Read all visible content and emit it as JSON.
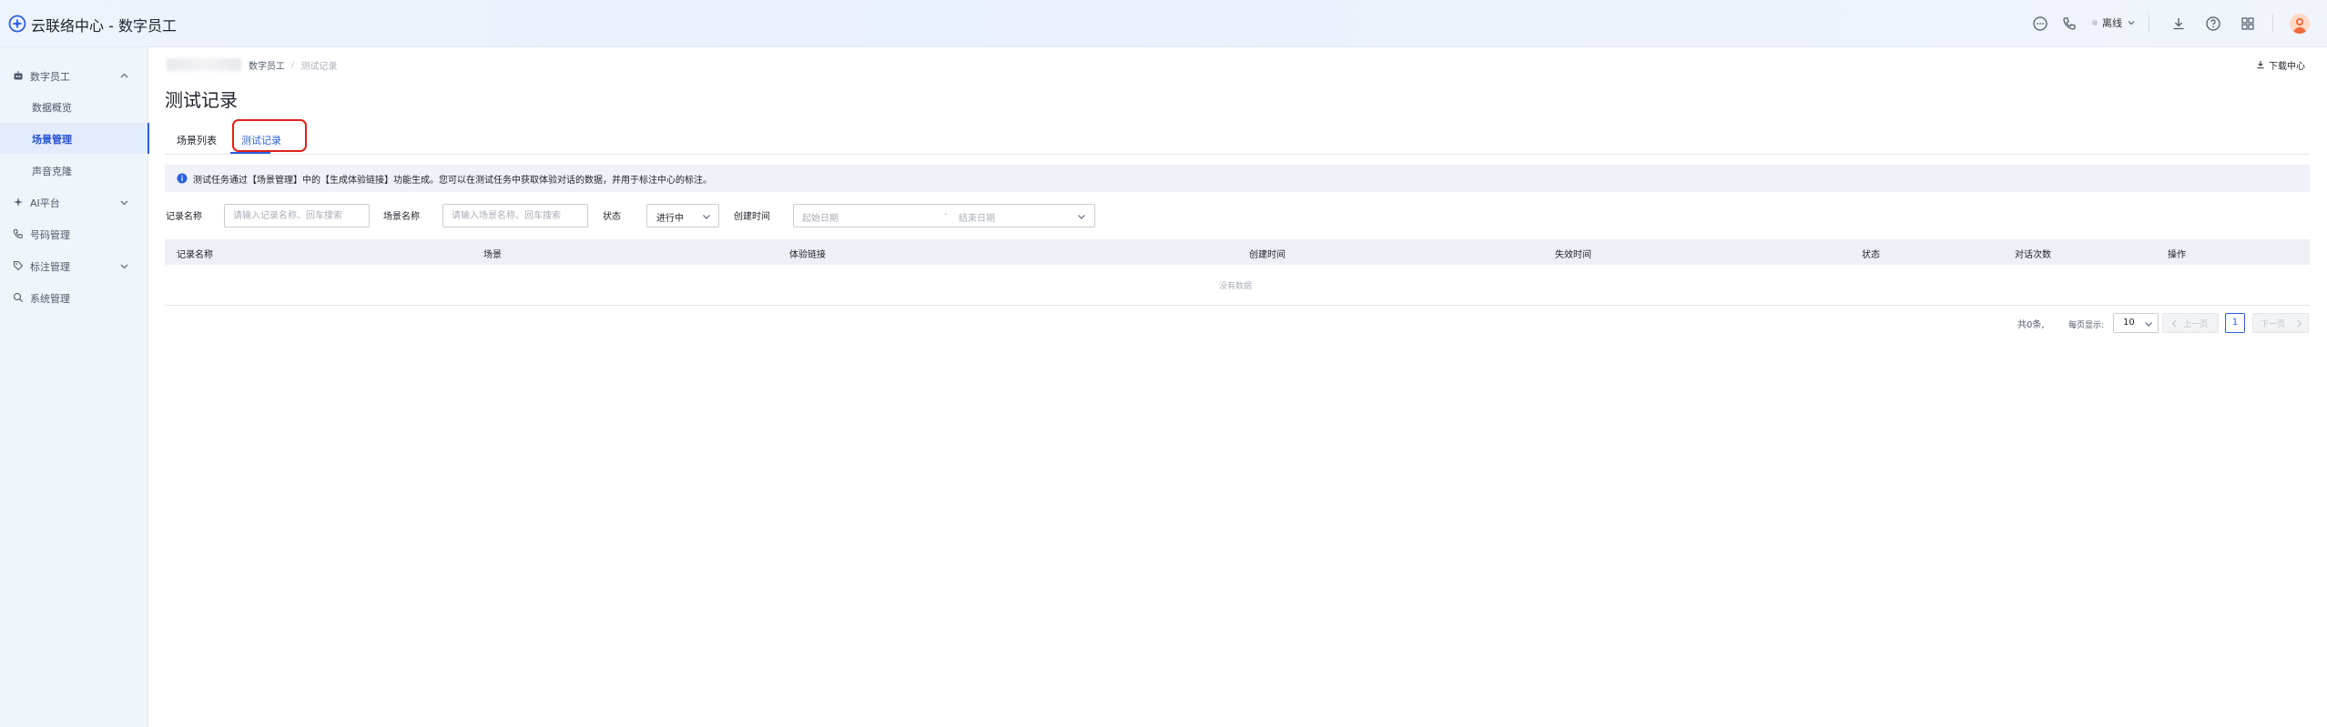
{
  "header": {
    "app_title": "云联络中心 - 数字员工",
    "status_label": "离线"
  },
  "sidebar": {
    "items": [
      {
        "label": "数字员工",
        "icon": "robot-icon",
        "expanded": true
      },
      {
        "label": "数据概览"
      },
      {
        "label": "场景管理",
        "active": true
      },
      {
        "label": "声音克隆"
      },
      {
        "label": "AI平台",
        "icon": "ai-icon",
        "expanded": false
      },
      {
        "label": "号码管理",
        "icon": "phone-icon"
      },
      {
        "label": "标注管理",
        "icon": "tag-icon",
        "expanded": false
      },
      {
        "label": "系统管理",
        "icon": "search-icon"
      }
    ]
  },
  "breadcrumb": {
    "parent": "数字员工",
    "separator": "/",
    "current": "测试记录"
  },
  "download_center_label": "下载中心",
  "page_title": "测试记录",
  "tabs": [
    {
      "label": "场景列表",
      "active": false
    },
    {
      "label": "测试记录",
      "active": true
    }
  ],
  "notice": {
    "text": "测试任务通过【场景管理】中的【生成体验链接】功能生成。您可以在测试任务中获取体验对话的数据，并用于标注中心的标注。"
  },
  "filters": {
    "record_name": {
      "label": "记录名称",
      "placeholder": "请输入记录名称、回车搜索"
    },
    "scene_name": {
      "label": "场景名称",
      "placeholder": "请输入场景名称、回车搜索"
    },
    "status": {
      "label": "状态",
      "value": "进行中"
    },
    "created_time": {
      "label": "创建时间",
      "start_placeholder": "起始日期",
      "separator": "-",
      "end_placeholder": "结束日期"
    }
  },
  "table": {
    "columns": [
      "记录名称",
      "场景",
      "体验链接",
      "创建时间",
      "失效时间",
      "状态",
      "对话次数",
      "操作"
    ],
    "rows": [],
    "empty_text": "没有数据"
  },
  "pagination": {
    "total_text": "共0条,",
    "page_size_label": "每页显示:",
    "page_size": "10",
    "prev_label": "上一页",
    "next_label": "下一页",
    "current_page": "1"
  },
  "colors": {
    "accent": "#2b5fe0",
    "highlight_box": "#e0211b",
    "sidebar_bg": "#f0f4fb",
    "header_bg": "#eef3fc"
  }
}
